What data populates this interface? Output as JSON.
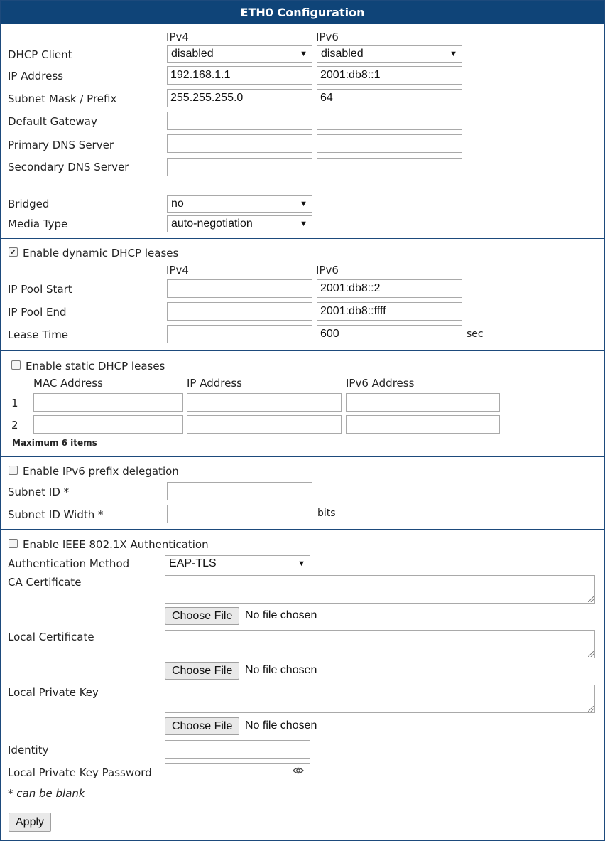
{
  "header": {
    "title": "ETH0 Configuration"
  },
  "ip": {
    "col_ipv4": "IPv4",
    "col_ipv6": "IPv6",
    "dhcp_client_label": "DHCP Client",
    "dhcp_client_ipv4": "disabled",
    "dhcp_client_ipv6": "disabled",
    "ip_address_label": "IP Address",
    "ip_address_ipv4": "192.168.1.1",
    "ip_address_ipv6": "2001:db8::1",
    "subnet_label": "Subnet Mask / Prefix",
    "subnet_ipv4": "255.255.255.0",
    "subnet_ipv6": "64",
    "gateway_label": "Default Gateway",
    "gateway_ipv4": "",
    "gateway_ipv6": "",
    "primary_dns_label": "Primary DNS Server",
    "primary_dns_ipv4": "",
    "primary_dns_ipv6": "",
    "secondary_dns_label": "Secondary DNS Server",
    "secondary_dns_ipv4": "",
    "secondary_dns_ipv6": ""
  },
  "bridge": {
    "bridged_label": "Bridged",
    "bridged_value": "no",
    "media_label": "Media Type",
    "media_value": "auto-negotiation"
  },
  "dyn_dhcp": {
    "enable_label": "Enable dynamic DHCP leases",
    "checked": true,
    "col_ipv4": "IPv4",
    "col_ipv6": "IPv6",
    "pool_start_label": "IP Pool Start",
    "pool_start_ipv4": "",
    "pool_start_ipv6": "2001:db8::2",
    "pool_end_label": "IP Pool End",
    "pool_end_ipv4": "",
    "pool_end_ipv6": "2001:db8::ffff",
    "lease_label": "Lease Time",
    "lease_ipv4": "",
    "lease_ipv6": "600",
    "lease_unit": "sec"
  },
  "static_dhcp": {
    "enable_label": "Enable static DHCP leases",
    "checked": false,
    "col_mac": "MAC Address",
    "col_ip": "IP Address",
    "col_ipv6": "IPv6 Address",
    "rows": [
      {
        "num": "1",
        "mac": "",
        "ip": "",
        "ipv6": ""
      },
      {
        "num": "2",
        "mac": "",
        "ip": "",
        "ipv6": ""
      }
    ],
    "max_note": "Maximum 6 items"
  },
  "prefix_delegation": {
    "enable_label": "Enable IPv6 prefix delegation",
    "checked": false,
    "subnet_id_label": "Subnet ID *",
    "subnet_id_value": "",
    "subnet_width_label": "Subnet ID Width *",
    "subnet_width_value": "",
    "width_unit": "bits"
  },
  "auth": {
    "enable_label": "Enable IEEE 802.1X Authentication",
    "checked": false,
    "method_label": "Authentication Method",
    "method_value": "EAP-TLS",
    "ca_label": "CA Certificate",
    "local_cert_label": "Local Certificate",
    "local_key_label": "Local Private Key",
    "choose_file": "Choose File",
    "no_file": "No file chosen",
    "identity_label": "Identity",
    "identity_value": "",
    "key_password_label": "Local Private Key Password",
    "key_password_value": "",
    "blank_note": "* can be blank"
  },
  "footer": {
    "apply_label": "Apply"
  }
}
